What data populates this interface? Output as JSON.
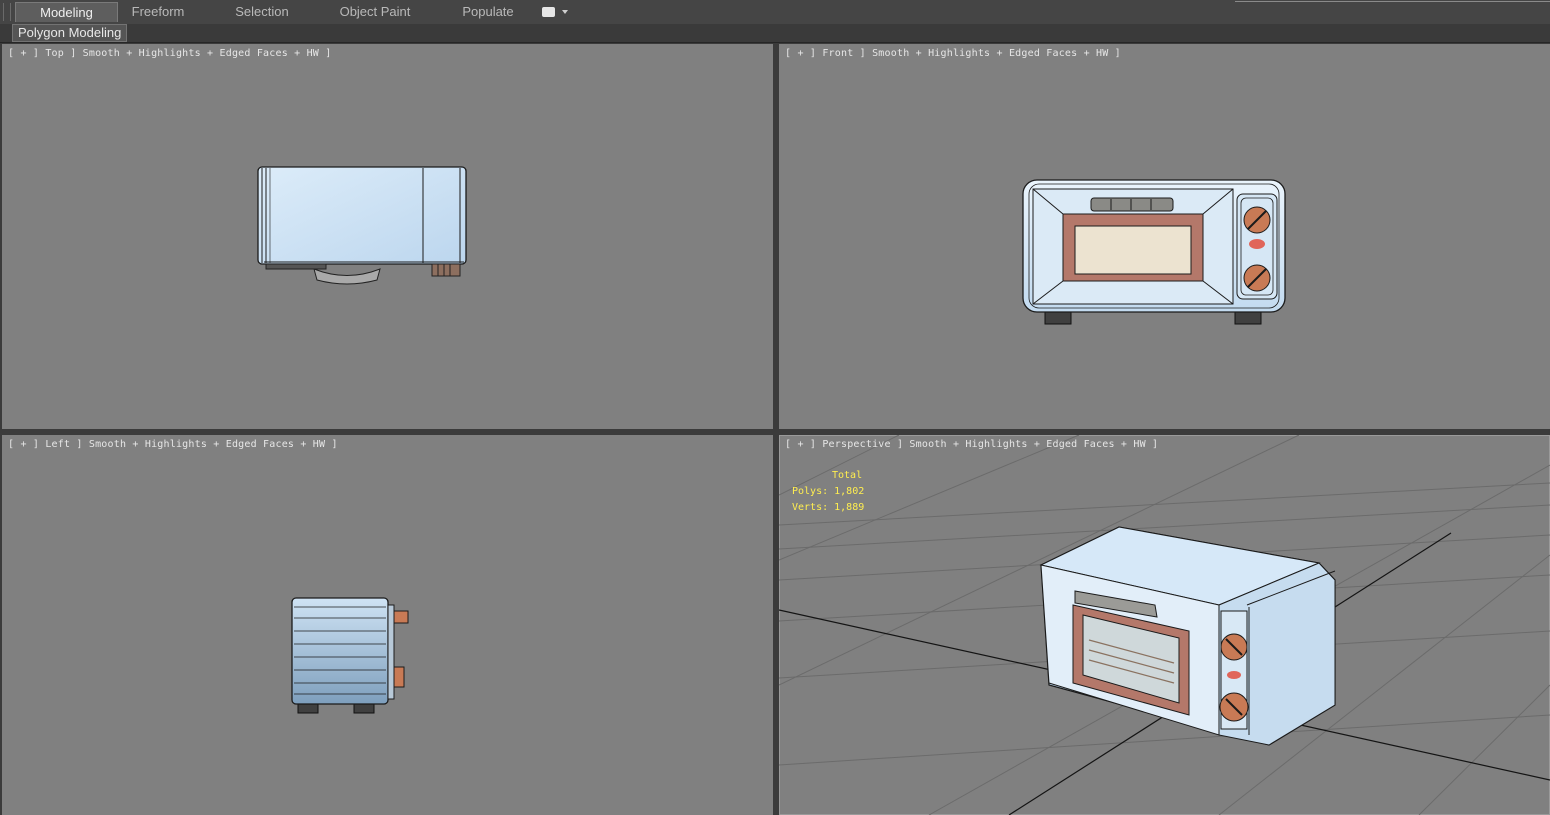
{
  "ribbon": {
    "tabs": [
      {
        "label": "Modeling",
        "active": true
      },
      {
        "label": "Freeform",
        "active": false
      },
      {
        "label": "Selection",
        "active": false
      },
      {
        "label": "Object Paint",
        "active": false
      },
      {
        "label": "Populate",
        "active": false
      }
    ],
    "toggle_icon": "display-toggle-icon"
  },
  "subpanel": {
    "label": "Polygon Modeling"
  },
  "viewports": {
    "top": {
      "label": "[ + ] Top ] Smooth + Highlights + Edged Faces + HW ]"
    },
    "front": {
      "label": "[ + ] Front ] Smooth + Highlights + Edged Faces + HW ]"
    },
    "left": {
      "label": "[ + ] Left ] Smooth + Highlights + Edged Faces + HW ]"
    },
    "perspective": {
      "label": "[ + ] Perspective ] Smooth + Highlights + Edged Faces + HW ]",
      "stats": {
        "total": "Total",
        "polys": "Polys: 1,802",
        "verts": "Verts: 1,889"
      }
    }
  },
  "colors": {
    "viewport_bg": "#808080",
    "model_body": "#cfe4f5",
    "door_frame": "#b4786a",
    "knob": "#c87a55",
    "stats_text": "#ffee4f",
    "grid_line": "#6e6e6e"
  }
}
